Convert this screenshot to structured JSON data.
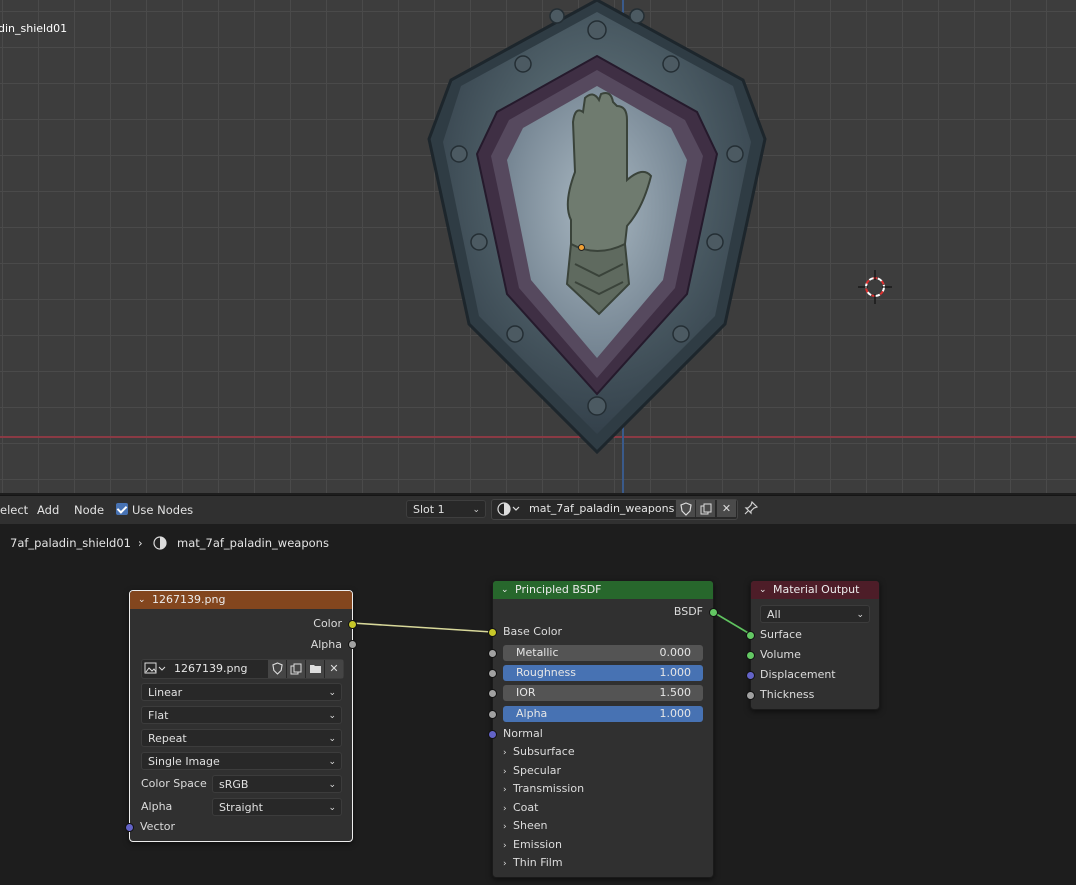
{
  "viewport": {
    "object_name": "din_shield01"
  },
  "header": {
    "menu_select": "elect",
    "menu_add": "Add",
    "menu_node": "Node",
    "use_nodes_label": "Use Nodes",
    "use_nodes_checked": true,
    "slot_label": "Slot 1",
    "material_name": "mat_7af_paladin_weapons"
  },
  "breadcrumb": {
    "object": "7af_paladin_shield01",
    "separator": "›",
    "material": "mat_7af_paladin_weapons"
  },
  "image_node": {
    "title": "1267139.png",
    "header_color": "#83461e",
    "out_color": "Color",
    "out_alpha": "Alpha",
    "image_name": "1267139.png",
    "interpolation": "Linear",
    "projection": "Flat",
    "extension": "Repeat",
    "source": "Single Image",
    "color_space_label": "Color Space",
    "color_space": "sRGB",
    "alpha_label": "Alpha",
    "alpha_mode": "Straight",
    "in_vector": "Vector"
  },
  "bsdf_node": {
    "title": "Principled BSDF",
    "header_color": "#27672c",
    "out_bsdf": "BSDF",
    "base_color": "Base Color",
    "metallic_label": "Metallic",
    "metallic_value": "0.000",
    "roughness_label": "Roughness",
    "roughness_value": "1.000",
    "ior_label": "IOR",
    "ior_value": "1.500",
    "alpha_label": "Alpha",
    "alpha_value": "1.000",
    "normal": "Normal",
    "sections": [
      "Subsurface",
      "Specular",
      "Transmission",
      "Coat",
      "Sheen",
      "Emission",
      "Thin Film"
    ]
  },
  "output_node": {
    "title": "Material Output",
    "header_color": "#4d1d28",
    "target": "All",
    "surface": "Surface",
    "volume": "Volume",
    "displacement": "Displacement",
    "thickness": "Thickness"
  }
}
